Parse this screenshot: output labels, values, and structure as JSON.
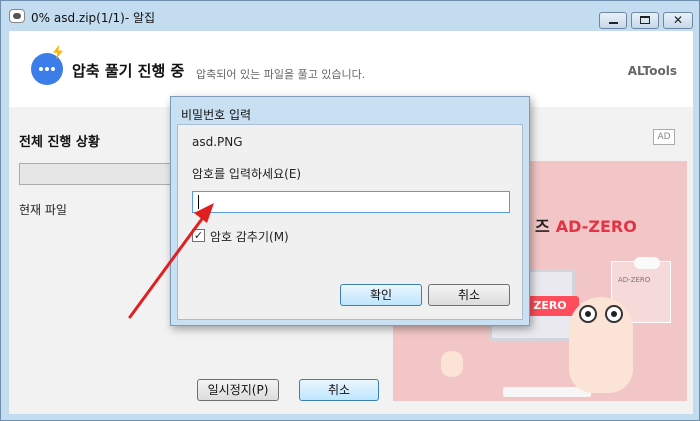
{
  "window": {
    "title": "0% asd.zip(1/1)- 알집",
    "close_glyph": "✕"
  },
  "header": {
    "title": "압축 풀기 진행 중",
    "subtitle": "압축되어 있는 파일을 풀고 있습니다.",
    "brand": "ALTools",
    "icon": "chat-bolt-icon",
    "accent": "#3b7de9"
  },
  "progress": {
    "label": "전체 진행 상황",
    "percent": 0,
    "current_file_label": "현재 파일"
  },
  "ad": {
    "badge": "AD",
    "headline_prefix": "즈",
    "headline": "AD-ZERO",
    "tag": "ZERO",
    "panel_label": "AD-ZERO",
    "accent": "#e33446"
  },
  "buttons": {
    "pause": "일시정지(P)",
    "cancel": "취소"
  },
  "dialog": {
    "title": "비밀번호 입력",
    "file_name": "asd.PNG",
    "prompt": "암호를 입력하세요(E)",
    "password_value": "",
    "hide_password_label": "암호 감추기(M)",
    "hide_password_checked": true,
    "check_glyph": "✓",
    "ok": "확인",
    "cancel": "취소"
  },
  "annotation": {
    "arrow_color": "#e02020"
  }
}
